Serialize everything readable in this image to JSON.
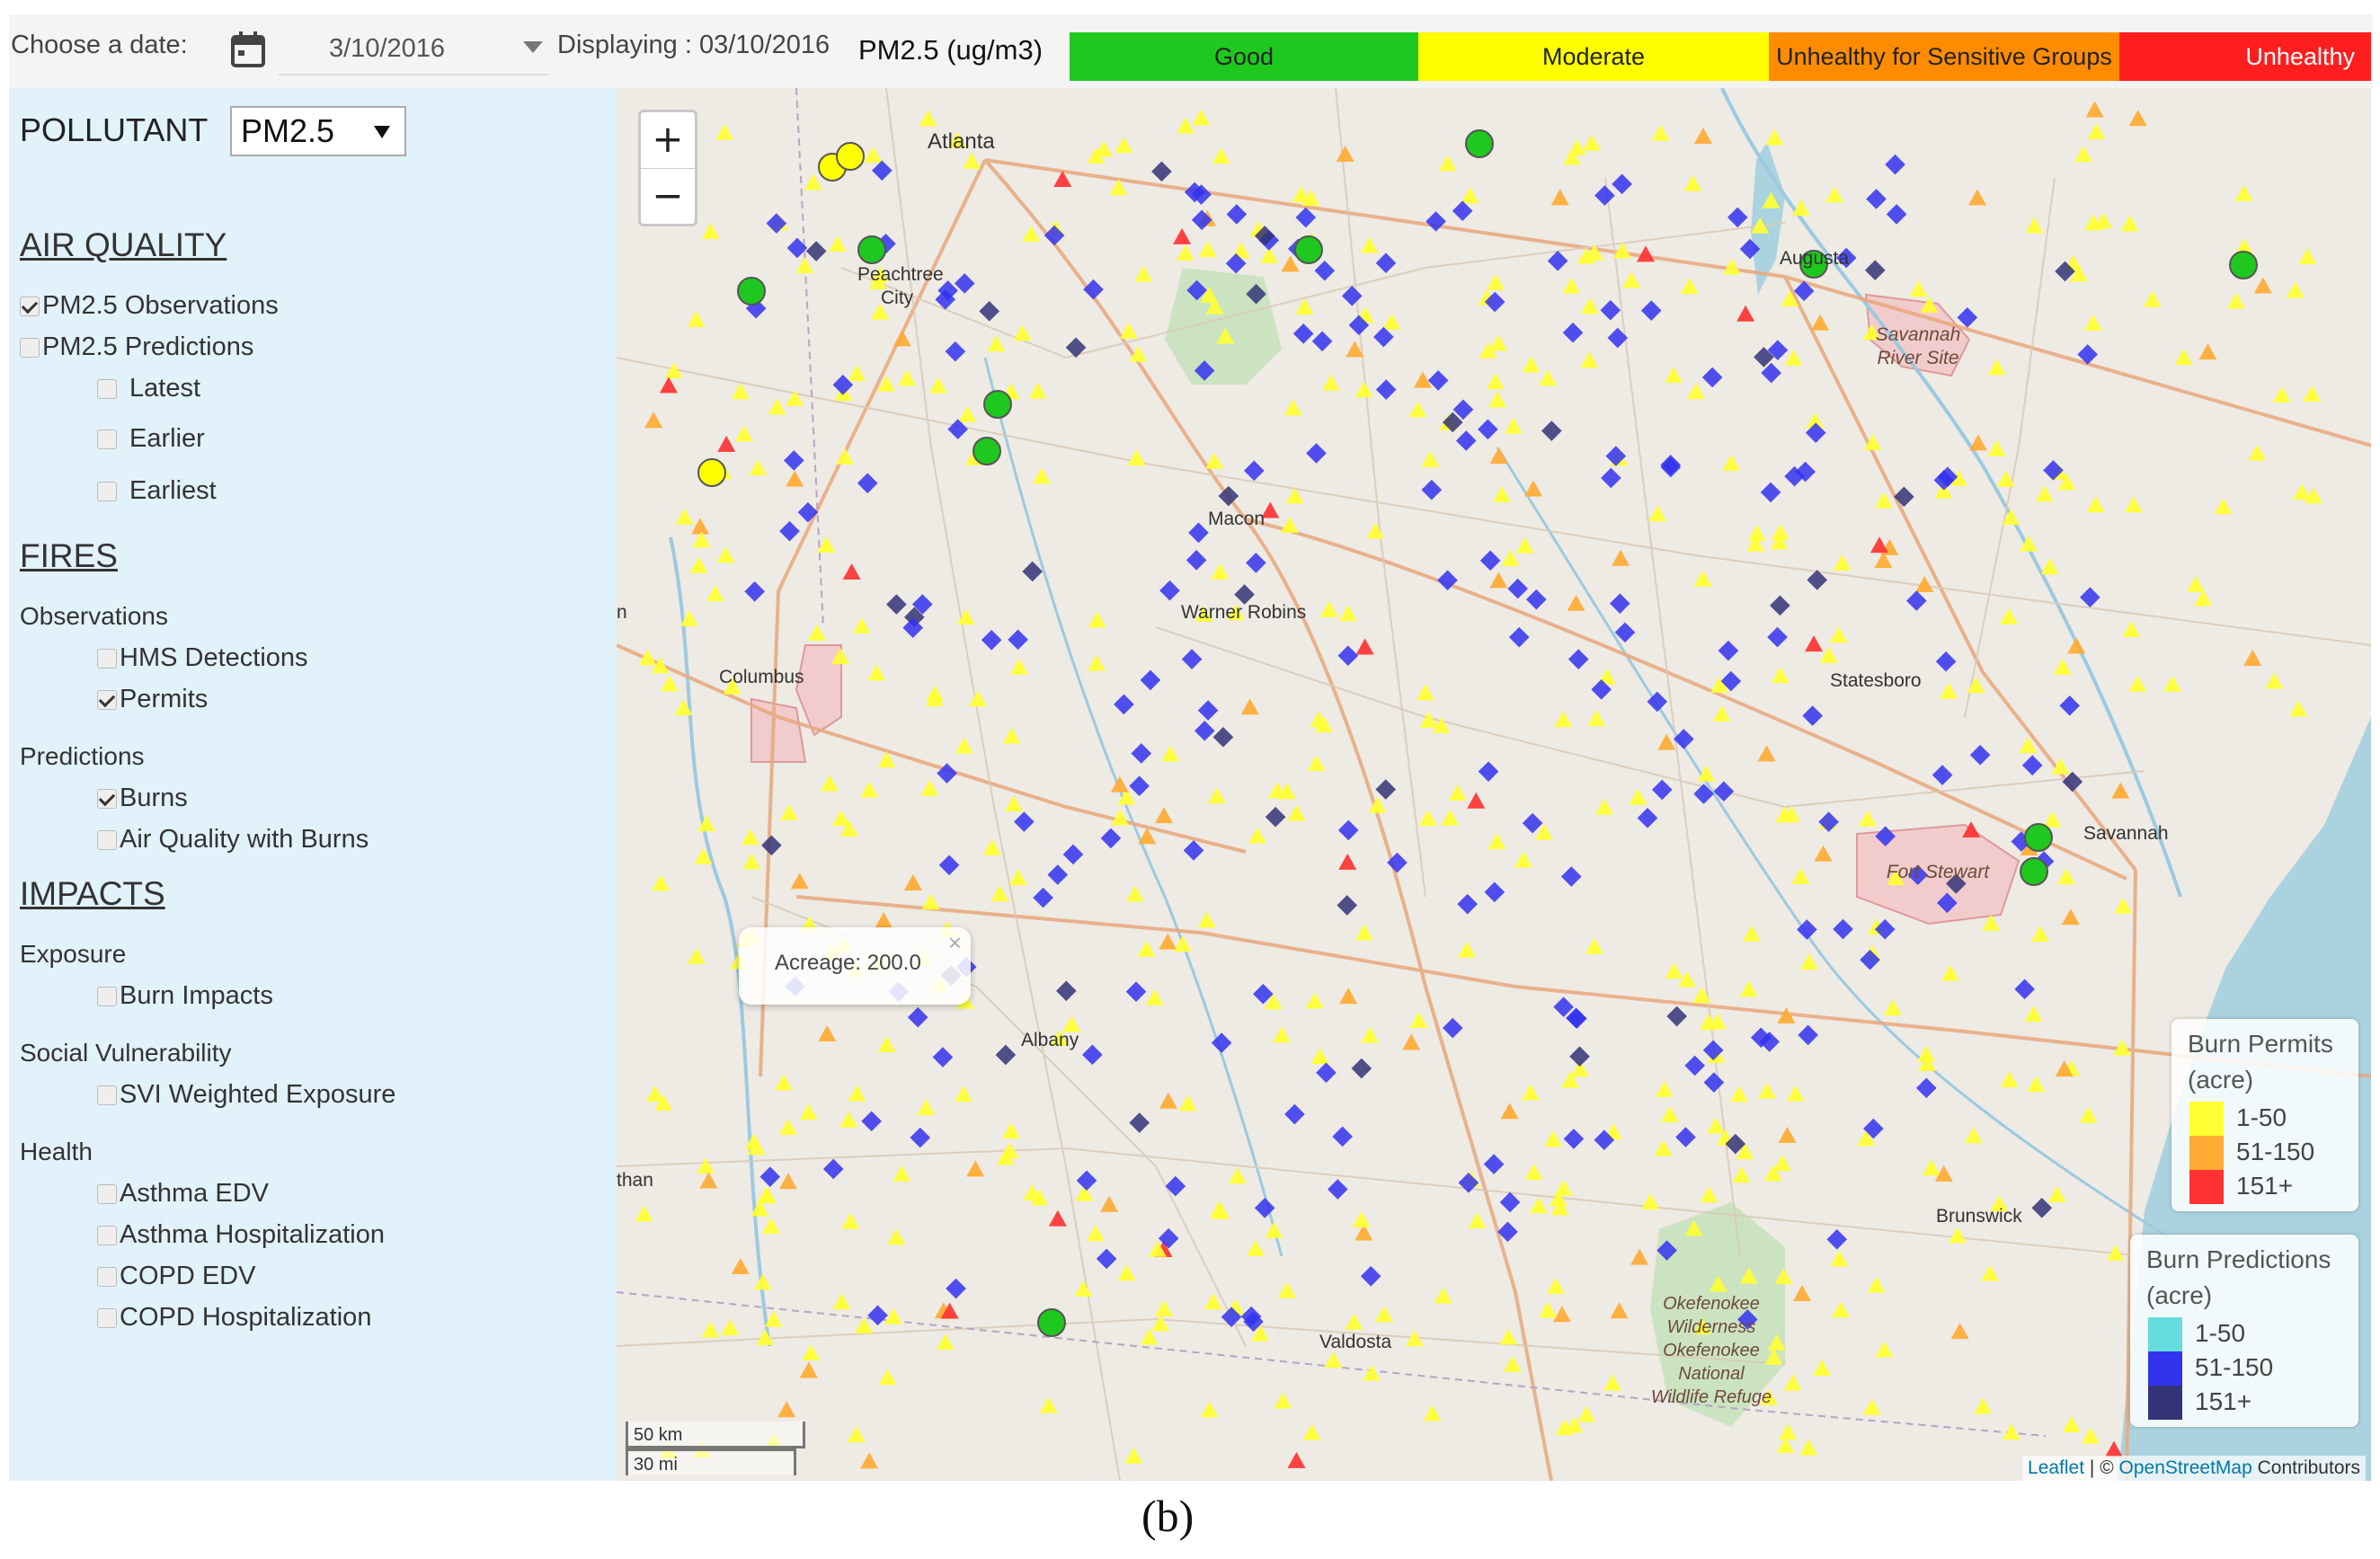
{
  "header": {
    "choose_date_label": "Choose a date:",
    "date_value": "3/10/2016",
    "displaying_text": "Displaying : 03/10/2016",
    "pm_label": "PM2.5 (ug/m3)",
    "aq_categories": [
      {
        "label": "Good",
        "color": "#1ec81e",
        "text_color": "#222222"
      },
      {
        "label": "Moderate",
        "color": "#ffff00",
        "text_color": "#222222"
      },
      {
        "label": "Unhealthy for Sensitive Groups",
        "color": "#ff8c00",
        "text_color": "#222222"
      },
      {
        "label": "Unhealthy",
        "color": "#ff1e1e",
        "text_color": "#ffffff"
      }
    ]
  },
  "sidebar": {
    "pollutant_label": "POLLUTANT",
    "pollutant_value": "PM2.5",
    "air_quality": {
      "title": "AIR QUALITY",
      "pm_observations": {
        "label": "PM2.5 Observations",
        "checked": true
      },
      "pm_predictions": {
        "label": "PM2.5 Predictions",
        "checked": false
      },
      "latest": {
        "label": "Latest",
        "checked": false
      },
      "earlier": {
        "label": "Earlier",
        "checked": false
      },
      "earliest": {
        "label": "Earliest",
        "checked": false
      }
    },
    "fires": {
      "title": "FIRES",
      "observations_label": "Observations",
      "hms": {
        "label": "HMS Detections",
        "checked": false
      },
      "permits": {
        "label": "Permits",
        "checked": true
      },
      "predictions_label": "Predictions",
      "burns": {
        "label": "Burns",
        "checked": true
      },
      "aq_with_burns": {
        "label": "Air Quality with Burns",
        "checked": false
      }
    },
    "impacts": {
      "title": "IMPACTS",
      "exposure_label": "Exposure",
      "burn_impacts": {
        "label": "Burn Impacts",
        "checked": false
      },
      "social_label": "Social Vulnerability",
      "svi": {
        "label": "SVI Weighted Exposure",
        "checked": false
      },
      "health_label": "Health",
      "asthma_edv": {
        "label": "Asthma EDV",
        "checked": false
      },
      "asthma_hosp": {
        "label": "Asthma Hospitalization",
        "checked": false
      },
      "copd_edv": {
        "label": "COPD EDV",
        "checked": false
      },
      "copd_hosp": {
        "label": "COPD Hospitalization",
        "checked": false
      }
    }
  },
  "map": {
    "zoom_in": "+",
    "zoom_out": "−",
    "popup_text": "Acreage: 200.0",
    "popup_close": "×",
    "cities": {
      "atlanta": "Atlanta",
      "peachtree": "Peachtree",
      "peachtree2": "City",
      "augusta": "Augusta",
      "macon": "Macon",
      "warner_robins": "Warner Robins",
      "columbus": "Columbus",
      "statesboro": "Statesboro",
      "savannah": "Savannah",
      "albany": "Albany",
      "valdosta": "Valdosta",
      "brunswick": "Brunswick",
      "n_edge": "n",
      "than_edge": "than"
    },
    "areas": {
      "savannah_river": "Savannah River Site",
      "fort_stewart": "Fort Stewart",
      "okefenokee": "Okefenokee Wilderness Okefenokee National Wildlife Refuge"
    },
    "scale": {
      "km": "50 km",
      "mi": "30 mi"
    },
    "attribution": {
      "leaflet": "Leaflet",
      "sep": " | © ",
      "osm": "OpenStreetMap",
      "contrib": " Contributors"
    },
    "legend_permits": {
      "title": "Burn Permits (acre)",
      "items": [
        {
          "label": "1-50",
          "color": "#ffff33"
        },
        {
          "label": "51-150",
          "color": "#ffaa33"
        },
        {
          "label": "151+",
          "color": "#ff3333"
        }
      ]
    },
    "legend_predictions": {
      "title": "Burn Predictions (acre)",
      "items": [
        {
          "label": "1-50",
          "color": "#66dddd"
        },
        {
          "label": "51-150",
          "color": "#3333ee"
        },
        {
          "label": "151+",
          "color": "#333377"
        }
      ]
    }
  },
  "caption": "(b)"
}
